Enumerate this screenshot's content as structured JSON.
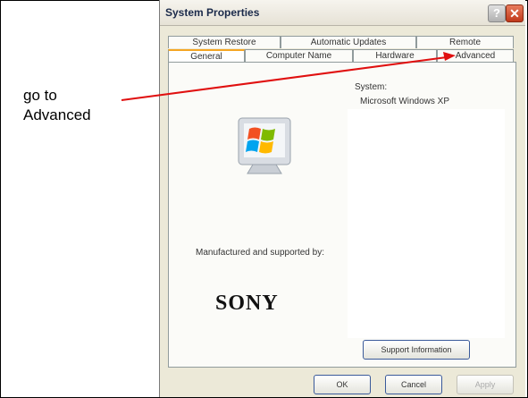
{
  "annotation": {
    "line1": "go to",
    "line2": "Advanced"
  },
  "dialog": {
    "title": "System Properties",
    "help_symbol": "?",
    "close_symbol": "✕",
    "tabs_row1": [
      "System Restore",
      "Automatic Updates",
      "Remote"
    ],
    "tabs_row2": [
      "General",
      "Computer Name",
      "Hardware",
      "Advanced"
    ],
    "selected_tab": "General",
    "system_label": "System:",
    "os_name": "Microsoft Windows XP",
    "manufacturer_label": "Manufactured and supported by:",
    "manufacturer_logo": "SONY",
    "support_button": "Support Information",
    "buttons": {
      "ok": "OK",
      "cancel": "Cancel",
      "apply": "Apply"
    }
  },
  "colors": {
    "arrow": "#e01010",
    "tab_highlight": "#f5a623",
    "dialog_bg": "#ece9d8"
  }
}
